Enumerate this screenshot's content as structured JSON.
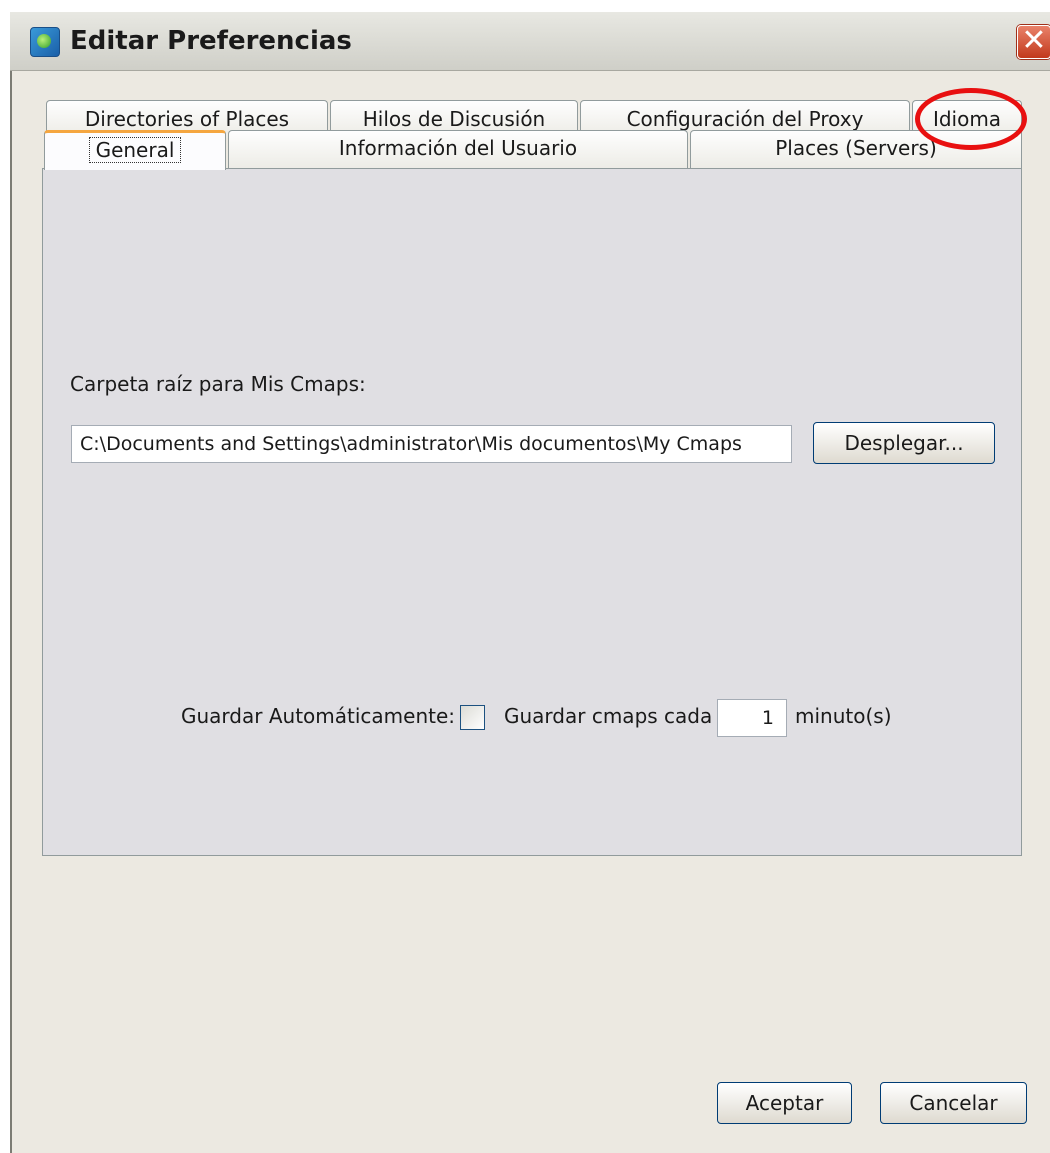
{
  "window": {
    "title": "Editar Preferencias",
    "close_symbol": "✕"
  },
  "icons": {
    "app": "cmaptools-app-icon",
    "close": "close-icon"
  },
  "tabs": {
    "back_row": [
      {
        "label": "Directories of Places"
      },
      {
        "label": "Hilos de Discusión"
      },
      {
        "label": "Configuración del Proxy"
      },
      {
        "label": "Idioma"
      }
    ],
    "front_row": [
      {
        "label": "General",
        "selected": true
      },
      {
        "label": "Información del Usuario"
      },
      {
        "label": "Places (Servers)"
      }
    ]
  },
  "general": {
    "root_folder_label": "Carpeta raíz para Mis Cmaps:",
    "root_folder_value": "C:\\Documents and Settings\\administrator\\Mis documentos\\My Cmaps",
    "browse_button": "Desplegar...",
    "autosave_label": "Guardar Automáticamente:",
    "autosave_checked": false,
    "save_every_label": "Guardar cmaps cada",
    "interval_value": "1",
    "interval_unit": "minuto(s)"
  },
  "footer": {
    "accept_button": "Aceptar",
    "cancel_button": "Cancelar"
  },
  "annotation": {
    "highlight_color": "#e81010"
  }
}
